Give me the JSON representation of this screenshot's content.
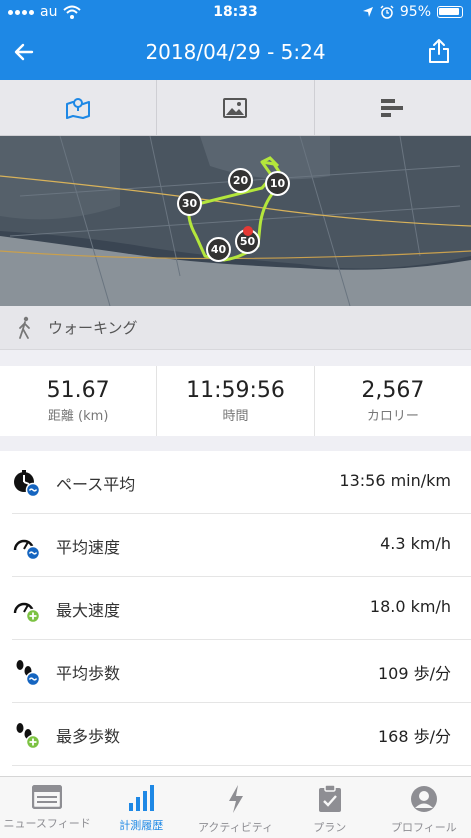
{
  "status_bar": {
    "carrier": "au",
    "time": "18:33",
    "battery": "95%",
    "icons": [
      "signal-dots-icon",
      "wifi-icon",
      "location-arrow-icon",
      "alarm-icon",
      "battery-icon"
    ]
  },
  "header": {
    "title": "2018/04/29 - 5:24",
    "back_icon": "arrow-left-icon",
    "share_icon": "share-icon",
    "background": "#1e88e5"
  },
  "view_tabs": [
    {
      "icon": "map-icon",
      "selected": true
    },
    {
      "icon": "photo-icon",
      "selected": false
    },
    {
      "icon": "bar-list-icon",
      "selected": false
    }
  ],
  "map": {
    "markers": [
      "10",
      "20",
      "30",
      "40",
      "50"
    ],
    "route_color": "#b4e63c"
  },
  "activity": {
    "icon": "walking-icon",
    "label": "ウォーキング"
  },
  "summary": [
    {
      "value": "51.67",
      "label": "距離 (km)"
    },
    {
      "value": "11:59:56",
      "label": "時間"
    },
    {
      "value": "2,567",
      "label": "カロリー"
    }
  ],
  "stats": [
    {
      "icon": "pace-clock-icon",
      "label": "ペース平均",
      "value": "13:56 min/km"
    },
    {
      "icon": "speed-gauge-avg-icon",
      "label": "平均速度",
      "value": "4.3 km/h"
    },
    {
      "icon": "speed-gauge-max-icon",
      "label": "最大速度",
      "value": "18.0 km/h"
    },
    {
      "icon": "footsteps-avg-icon",
      "label": "平均歩数",
      "value": "109 歩/分"
    },
    {
      "icon": "footsteps-max-icon",
      "label": "最多歩数",
      "value": "168 歩/分"
    }
  ],
  "tabbar": [
    {
      "icon": "newsfeed-icon",
      "label": "ニュースフィード",
      "active": false
    },
    {
      "icon": "history-chart-icon",
      "label": "計測履歴",
      "active": true
    },
    {
      "icon": "lightning-icon",
      "label": "アクティビティ",
      "active": false
    },
    {
      "icon": "clipboard-icon",
      "label": "プラン",
      "active": false
    },
    {
      "icon": "profile-icon",
      "label": "プロフィール",
      "active": false
    }
  ],
  "colors": {
    "accent": "#1e88e5",
    "badge_blue": "#1565c0",
    "badge_green": "#7cc242"
  }
}
